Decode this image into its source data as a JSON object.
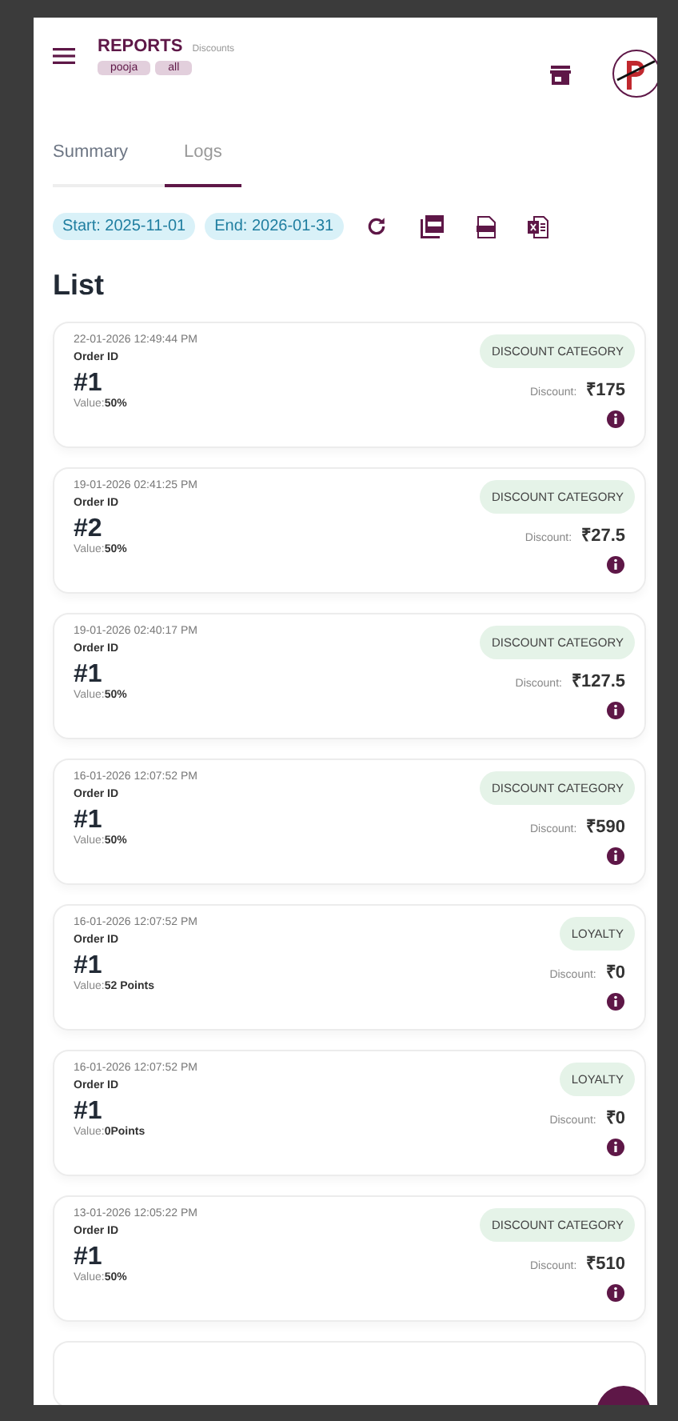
{
  "header": {
    "title": "REPORTS",
    "subtitle": "Discounts",
    "tags": [
      "pooja",
      "all"
    ]
  },
  "tabs": [
    {
      "label": "Summary",
      "selected": false
    },
    {
      "label": "Logs",
      "selected": true
    }
  ],
  "filters": {
    "start": "Start: 2025-11-01",
    "end": "End: 2026-01-31"
  },
  "list_title": "List",
  "logs": [
    {
      "time": "22-01-2026 12:49:44 PM",
      "id_label": "Order ID",
      "order": "#1",
      "value_label": "Value:",
      "value": "50%",
      "category": "DISCOUNT CATEGORY",
      "discount_label": "Discount:",
      "discount": "₹175"
    },
    {
      "time": "19-01-2026 02:41:25 PM",
      "id_label": "Order ID",
      "order": "#2",
      "value_label": "Value:",
      "value": "50%",
      "category": "DISCOUNT CATEGORY",
      "discount_label": "Discount:",
      "discount": "₹27.5"
    },
    {
      "time": "19-01-2026 02:40:17 PM",
      "id_label": "Order ID",
      "order": "#1",
      "value_label": "Value:",
      "value": "50%",
      "category": "DISCOUNT CATEGORY",
      "discount_label": "Discount:",
      "discount": "₹127.5"
    },
    {
      "time": "16-01-2026 12:07:52 PM",
      "id_label": "Order ID",
      "order": "#1",
      "value_label": "Value:",
      "value": "50%",
      "category": "DISCOUNT CATEGORY",
      "discount_label": "Discount:",
      "discount": "₹590"
    },
    {
      "time": "16-01-2026 12:07:52 PM",
      "id_label": "Order ID",
      "order": "#1",
      "value_label": "Value:",
      "value": "52 Points",
      "category": "LOYALTY",
      "discount_label": "Discount:",
      "discount": "₹0"
    },
    {
      "time": "16-01-2026 12:07:52 PM",
      "id_label": "Order ID",
      "order": "#1",
      "value_label": "Value:",
      "value": "0Points",
      "category": "LOYALTY",
      "discount_label": "Discount:",
      "discount": "₹0"
    },
    {
      "time": "13-01-2026 12:05:22 PM",
      "id_label": "Order ID",
      "order": "#1",
      "value_label": "Value:",
      "value": "50%",
      "category": "DISCOUNT CATEGORY",
      "discount_label": "Discount:",
      "discount": "₹510"
    }
  ]
}
